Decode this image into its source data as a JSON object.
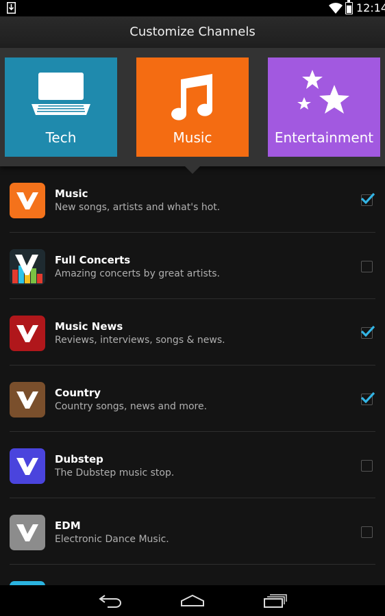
{
  "status_bar": {
    "time": "12:14"
  },
  "header": {
    "title": "Customize Channels"
  },
  "categories": [
    {
      "label": "Tech",
      "color": "#1f8aad",
      "icon": "laptop-icon"
    },
    {
      "label": "Music",
      "color": "#f46c12",
      "icon": "music-note-icon"
    },
    {
      "label": "Entertainment",
      "color": "#a259e0",
      "icon": "stars-icon"
    }
  ],
  "channels": [
    {
      "name": "Music",
      "description": "New songs, artists and what's hot.",
      "checked": true,
      "icon_color": "#f4721b"
    },
    {
      "name": "Full Concerts",
      "description": "Amazing concerts by great artists.",
      "checked": false,
      "icon_color": "#1e2a30"
    },
    {
      "name": "Music News",
      "description": "Reviews, interviews, songs & news.",
      "checked": true,
      "icon_color": "#b0171b"
    },
    {
      "name": "Country",
      "description": "Country songs, news and more.",
      "checked": true,
      "icon_color": "#7a4f2c"
    },
    {
      "name": "Dubstep",
      "description": "The Dubstep music stop.",
      "checked": false,
      "icon_color": "#4a44dd"
    },
    {
      "name": "EDM",
      "description": "Electronic Dance Music.",
      "checked": false,
      "icon_color": "#8c8c8c"
    }
  ],
  "accent_color": "#33b5e5"
}
